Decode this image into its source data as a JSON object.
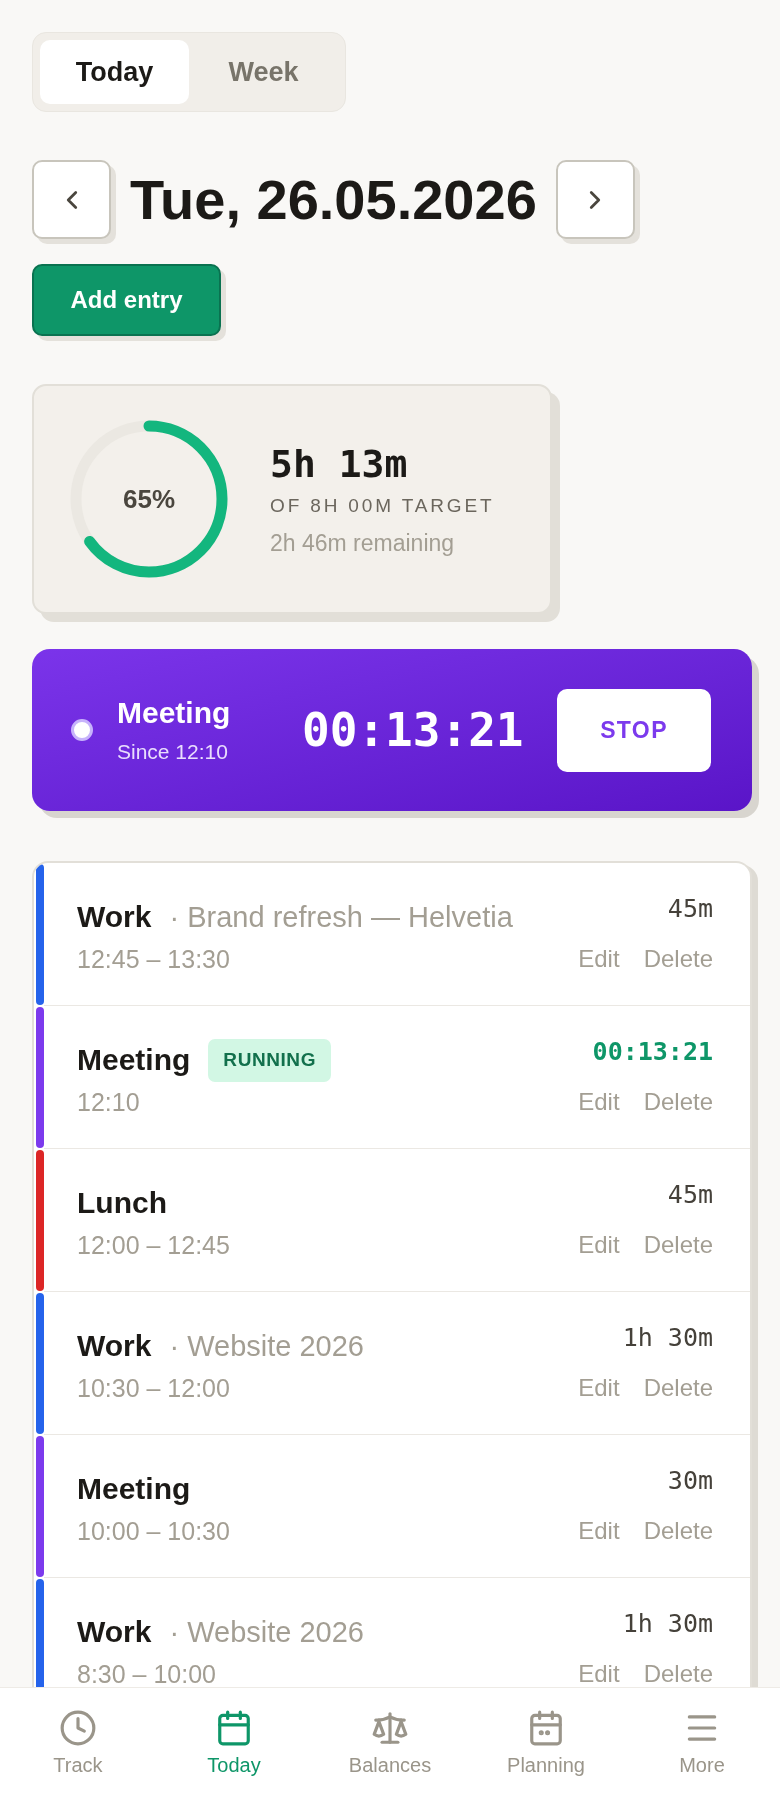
{
  "view_tabs": [
    {
      "label": "Today",
      "selected": true
    },
    {
      "label": "Week",
      "selected": false
    }
  ],
  "date_nav": {
    "title": "Tue, 26.05.2026"
  },
  "add_entry": {
    "label": "Add entry"
  },
  "daily_progress": {
    "percent": "65%",
    "level": 0.65,
    "tracked": "5h 13m",
    "target": "OF 8H 00M TARGET",
    "remaining": "2h 46m remaining"
  },
  "running_timer": {
    "activity": "Meeting",
    "since": "Since 12:10",
    "elapsed": "00:13:21",
    "stop": "STOP"
  },
  "entries": [
    {
      "title": "Work",
      "project": "· Brand refresh — Helvetia",
      "time": "12:45 – 13:30",
      "duration": "45m",
      "running": false,
      "color": "#2563eb",
      "actions": [
        "Edit",
        "Delete"
      ]
    },
    {
      "title": "Meeting",
      "badge": "RUNNING",
      "time": "12:10",
      "duration": "00:13:21",
      "running": true,
      "color": "#7c3aed",
      "actions": [
        "Edit",
        "Delete"
      ]
    },
    {
      "title": "Lunch",
      "time": "12:00 – 12:45",
      "duration": "45m",
      "running": false,
      "color": "#dc2626",
      "actions": [
        "Edit",
        "Delete"
      ]
    },
    {
      "title": "Work",
      "project": "· Website 2026",
      "time": "10:30 – 12:00",
      "duration": "1h 30m",
      "running": false,
      "color": "#2563eb",
      "actions": [
        "Edit",
        "Delete"
      ]
    },
    {
      "title": "Meeting",
      "time": "10:00 – 10:30",
      "duration": "30m",
      "running": false,
      "color": "#7c3aed",
      "actions": [
        "Edit",
        "Delete"
      ]
    },
    {
      "title": "Work",
      "project": "· Website 2026",
      "time": "8:30 – 10:00",
      "duration": "1h 30m",
      "running": false,
      "color": "#2563eb",
      "actions": [
        "Edit",
        "Delete"
      ]
    }
  ],
  "bottom_nav": [
    {
      "label": "Track",
      "selected": false
    },
    {
      "label": "Today",
      "selected": true
    },
    {
      "label": "Balances",
      "selected": false
    },
    {
      "label": "Planning",
      "selected": false
    },
    {
      "label": "More",
      "selected": false
    }
  ]
}
